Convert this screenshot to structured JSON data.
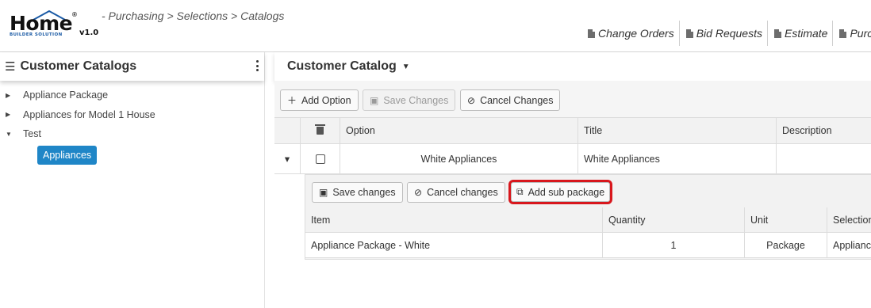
{
  "header": {
    "logo": {
      "word": "Home",
      "reg": "®",
      "sub": "BUILDER SOLUTION",
      "version": "v1.0"
    },
    "breadcrumb": "- Purchasing > Selections > Catalogs",
    "links": [
      {
        "label": "Change Orders",
        "icon": "document-icon"
      },
      {
        "label": "Bid Requests",
        "icon": "document-icon"
      },
      {
        "label": "Estimate",
        "icon": "document-icon"
      },
      {
        "label": "Purcha",
        "icon": "calculator-icon"
      }
    ]
  },
  "left_panel": {
    "title": "Customer Catalogs",
    "tree": [
      {
        "label": "Appliance Package",
        "expanded": false
      },
      {
        "label": "Appliances for Model 1 House",
        "expanded": false
      },
      {
        "label": "Test",
        "expanded": true
      }
    ],
    "selected_child": "Appliances"
  },
  "right_panel": {
    "title": "Customer Catalog",
    "toolbar": {
      "add_option": "Add Option",
      "save_changes": "Save Changes",
      "cancel_changes": "Cancel Changes"
    },
    "columns": {
      "option": "Option",
      "title": "Title",
      "description": "Description"
    },
    "row": {
      "option": "White Appliances",
      "title": "White Appliances",
      "description": ""
    },
    "detail": {
      "save_changes": "Save changes",
      "cancel_changes": "Cancel changes",
      "add_sub_package": "Add sub package",
      "columns": {
        "item": "Item",
        "quantity": "Quantity",
        "unit": "Unit",
        "selection": "Selection"
      },
      "row": {
        "item": "Appliance Package - White",
        "quantity": "1",
        "unit": "Package",
        "selection": "Applianc"
      }
    }
  },
  "colors": {
    "accent": "#1f86c7",
    "highlight_outline": "#d8171d",
    "logo_blue": "#1a5aa5"
  }
}
